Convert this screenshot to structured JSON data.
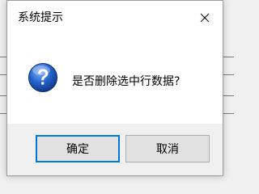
{
  "dialog": {
    "title": "系统提示",
    "message": "是否删除选中行数据?",
    "icon": "question-icon",
    "ok_label": "确定",
    "cancel_label": "取消"
  },
  "colors": {
    "focus_border": "#0078d7",
    "button_face": "#e1e1e1",
    "icon_blue": "#1f5fbf"
  }
}
